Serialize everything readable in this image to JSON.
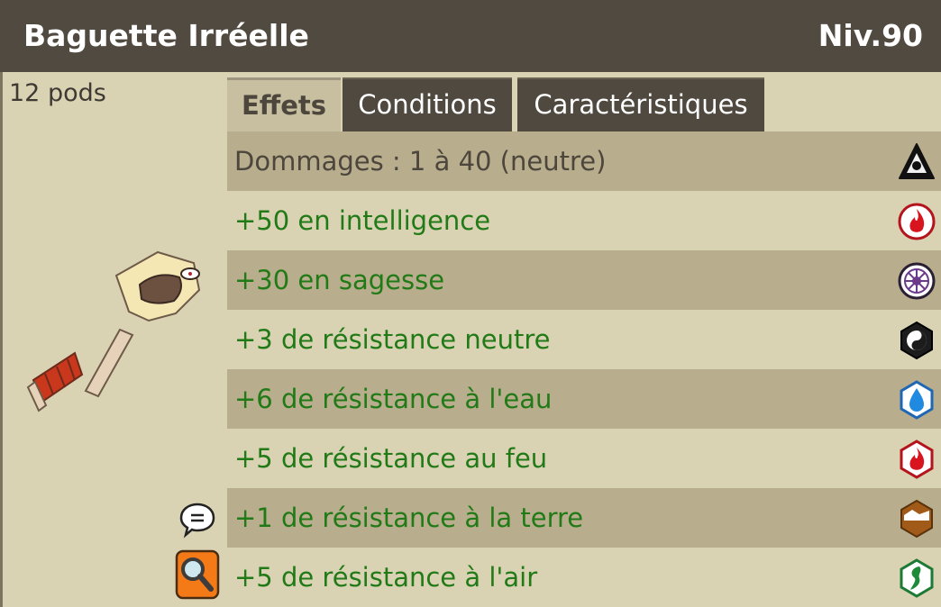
{
  "header": {
    "title": "Baguette Irréelle",
    "level": "Niv.90"
  },
  "item": {
    "weight": "12 pods"
  },
  "tabs": [
    {
      "label": "Effets",
      "active": true
    },
    {
      "label": "Conditions",
      "active": false
    },
    {
      "label": "Caractéristiques",
      "active": false
    }
  ],
  "effects": [
    {
      "text": "Dommages : 1 à 40 (neutre)",
      "icon": "neutral-damage-icon"
    },
    {
      "text": "+50 en intelligence",
      "icon": "intelligence-fire-icon"
    },
    {
      "text": "+30 en sagesse",
      "icon": "wisdom-icon"
    },
    {
      "text": "+3 de résistance neutre",
      "icon": "neutral-resistance-icon"
    },
    {
      "text": "+6 de résistance à l'eau",
      "icon": "water-resistance-icon"
    },
    {
      "text": "+5 de résistance au feu",
      "icon": "fire-resistance-icon"
    },
    {
      "text": "+1 de résistance à la terre",
      "icon": "earth-resistance-icon"
    },
    {
      "text": "+5 de résistance à l'air",
      "icon": "air-resistance-icon"
    }
  ],
  "colors": {
    "header_bg": "#514a40",
    "panel_bg": "#d9d3b4",
    "row_alt": "#b8ad8c",
    "effect_text": "#227a17"
  }
}
